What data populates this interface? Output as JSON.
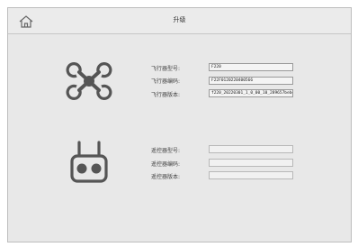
{
  "header": {
    "title": "升级"
  },
  "aircraft": {
    "rows": [
      {
        "label": "飞行器型号:",
        "value": "F220"
      },
      {
        "label": "飞行器编码:",
        "value": "F22F0120220400566"
      },
      {
        "label": "飞行器版本:",
        "value": "f220_20220301_1_0_00_10_289657bebd.bin"
      }
    ]
  },
  "controller": {
    "rows": [
      {
        "label": "遥控器型号:",
        "value": ""
      },
      {
        "label": "遥控器编码:",
        "value": ""
      },
      {
        "label": "遥控器版本:",
        "value": ""
      }
    ]
  }
}
